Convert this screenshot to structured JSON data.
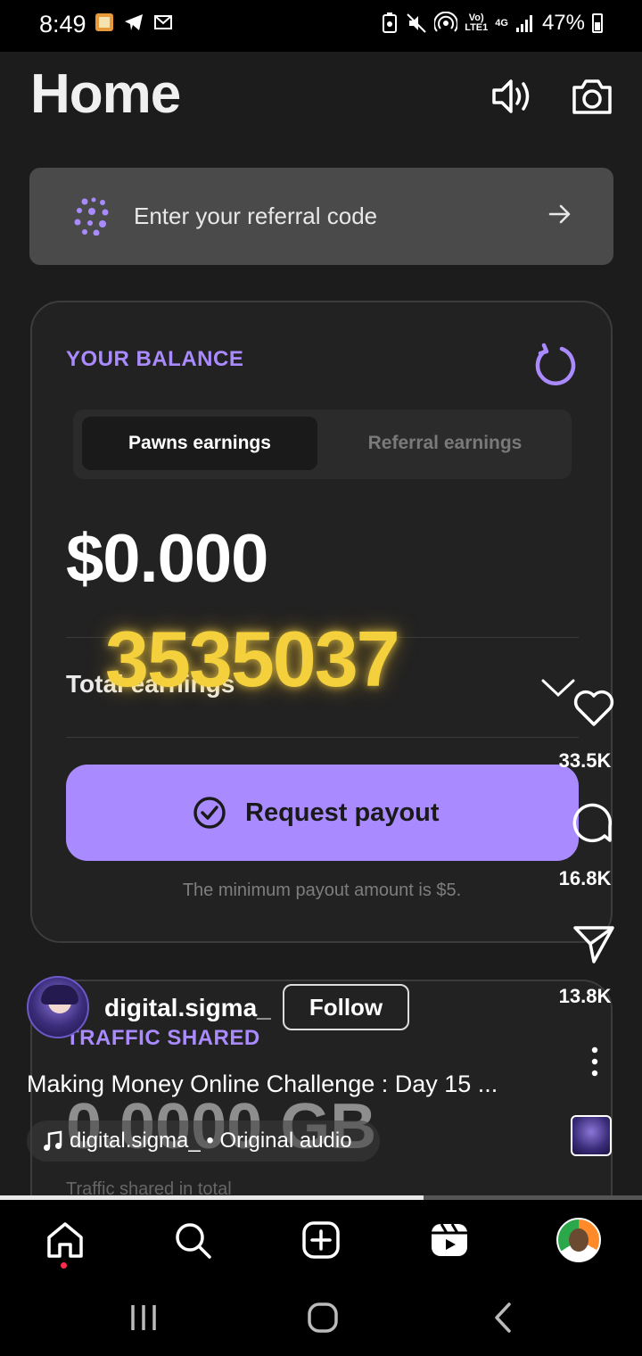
{
  "status_bar": {
    "time": "8:49",
    "network_top": "Vo)",
    "network_bottom": "LTE1",
    "network_type": "4G",
    "battery": "47%"
  },
  "header": {
    "title": "Home"
  },
  "referral": {
    "placeholder": "Enter your referral code"
  },
  "balance": {
    "label": "YOUR BALANCE",
    "tabs": [
      {
        "label": "Pawns earnings",
        "active": true
      },
      {
        "label": "Referral earnings",
        "active": false
      }
    ],
    "amount": "$0.000",
    "total_label": "Total earnings",
    "payout_button": "Request payout",
    "min_note": "The minimum payout amount is $5."
  },
  "traffic": {
    "label": "TRAFFIC SHARED",
    "value": "0.0000 GB",
    "sub": "Traffic shared in total"
  },
  "reel": {
    "overlay_number": "3535037",
    "likes": "33.5K",
    "comments": "16.8K",
    "shares": "13.8K",
    "username": "digital.sigma_",
    "follow_label": "Follow",
    "caption": "Making Money Online Challenge : Day 15 ...",
    "audio": "digital.sigma_ • Original audio",
    "progress": 0.66
  },
  "colors": {
    "accent": "#a98bff",
    "overlay_yellow": "#f4d13c",
    "notification_dot": "#ff2a4f"
  },
  "icons": {
    "header": [
      "speaker-icon",
      "camera-icon"
    ],
    "nav": [
      "home-icon",
      "search-icon",
      "create-icon",
      "reels-icon",
      "profile-avatar"
    ],
    "system_nav": [
      "recents-icon",
      "home-button-icon",
      "back-icon"
    ]
  }
}
